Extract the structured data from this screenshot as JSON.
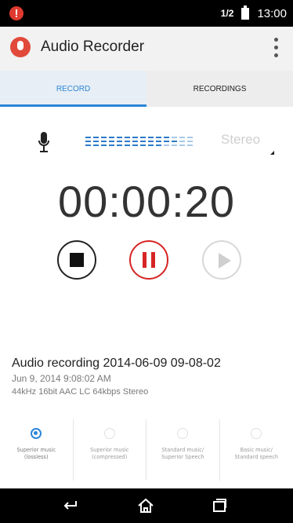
{
  "status_bar": {
    "time": "13:00",
    "signal": "1/2"
  },
  "app_bar": {
    "title": "Audio Recorder"
  },
  "tabs": [
    {
      "label": "RECORD",
      "active": true
    },
    {
      "label": "RECORDINGS",
      "active": false
    }
  ],
  "recorder": {
    "channel_mode": "Stereo",
    "timer": "00:00:20"
  },
  "recording": {
    "name": "Audio recording 2014-06-09 09-08-02",
    "date": "Jun 9, 2014 9:08:02 AM",
    "format": "44kHz 16bit AAC LC 64kbps Stereo"
  },
  "quality_options": [
    {
      "label": "Superior music\n(lossless)",
      "selected": true
    },
    {
      "label": "Superior music\n(compressed)",
      "selected": false
    },
    {
      "label": "Standard music/\nSuperior Speech",
      "selected": false
    },
    {
      "label": "Basic music/\nStandard speech",
      "selected": false
    }
  ],
  "colors": {
    "accent": "#2c86d7",
    "record_red": "#d62424",
    "app_logo": "#e14a3b"
  }
}
